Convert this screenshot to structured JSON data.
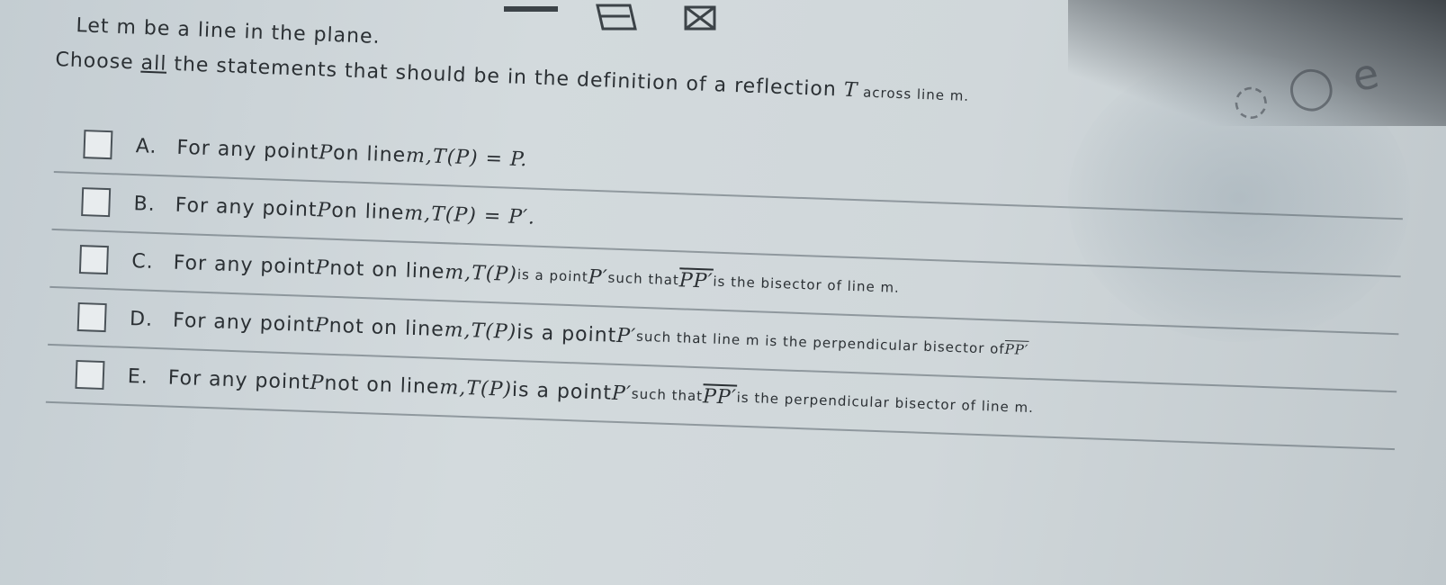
{
  "question": {
    "intro": "Let m be a line in the plane.",
    "prompt_before": "Choose ",
    "prompt_emph": "all",
    "prompt_after": " the statements that should be in the definition of a reflection ",
    "prompt_T": "T",
    "prompt_tail": " across line m."
  },
  "options": [
    {
      "letter": "A.",
      "text_a": "For any point ",
      "P": "P",
      "text_b": " on line ",
      "m": "m,",
      "formula": " T(P) = P."
    },
    {
      "letter": "B.",
      "text_a": "For any point ",
      "P": "P",
      "text_b": " on line ",
      "m": "m,",
      "formula": " T(P) = P′."
    },
    {
      "letter": "C.",
      "text_a": "For any point ",
      "P": "P",
      "text_b": " not on line ",
      "m": "m,",
      "formula": " T(P)",
      "text_c": " is a point ",
      "Pp": "P′",
      "text_d": " such that ",
      "seg": "PP′",
      "text_e": " is the bisector of line m."
    },
    {
      "letter": "D.",
      "text_a": "For any point ",
      "P": "P",
      "text_b": " not on line ",
      "m": "m,",
      "formula": " T(P)",
      "text_c": " is a point ",
      "Pp": "P′",
      "text_d": " such that line m is the perpendicular bisector of ",
      "seg": "PP′"
    },
    {
      "letter": "E.",
      "text_a": "For any point ",
      "P": "P",
      "text_b": " not on line ",
      "m": "m,",
      "formula": " T(P)",
      "text_c": " is a point ",
      "Pp": "P′",
      "text_d": " such that ",
      "seg": "PP′",
      "text_e": " is the perpendicular bisector of line m."
    }
  ],
  "icons": [
    "minimize-icon",
    "pencil-icon",
    "close-x-icon"
  ],
  "colors": {
    "background": "#d0d7da",
    "text": "#2b3034",
    "divider": "#5a646c"
  }
}
